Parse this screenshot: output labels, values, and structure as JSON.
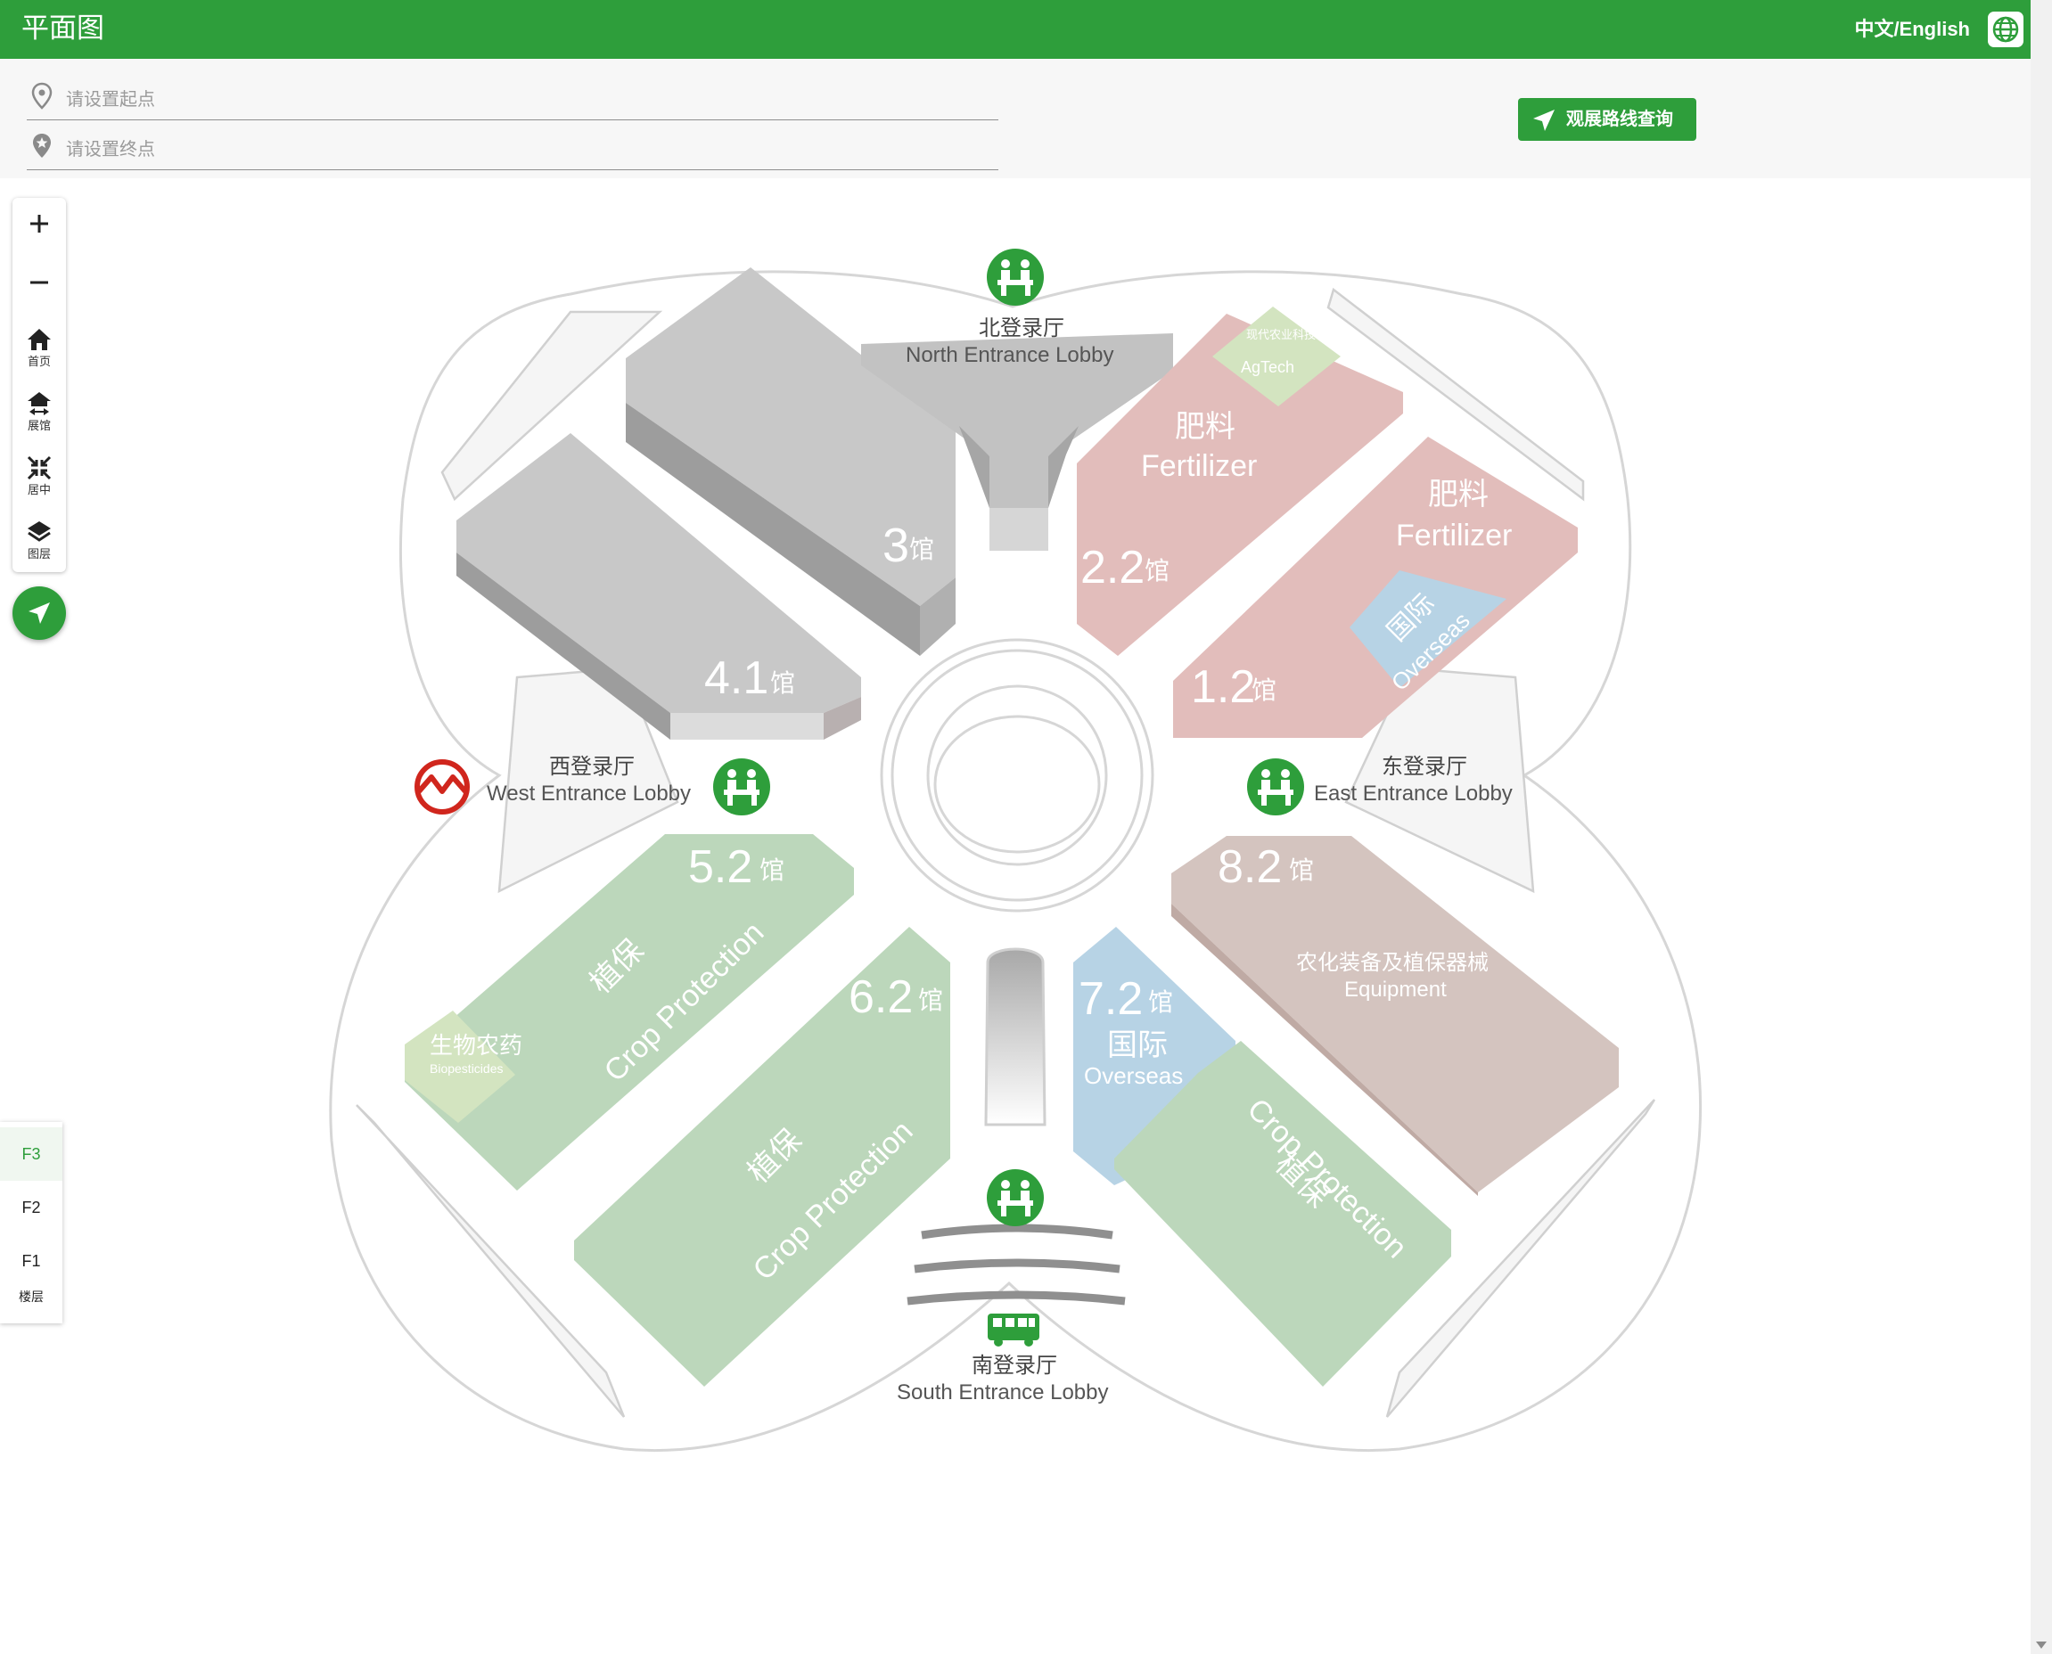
{
  "app": {
    "title": "平面图",
    "lang_toggle": "中文/English"
  },
  "route": {
    "start_placeholder": "请设置起点",
    "end_placeholder": "请设置终点",
    "query_label": "观展路线查询"
  },
  "tools": {
    "zoom_in": "zoom-in-icon",
    "zoom_out": "zoom-out-icon",
    "home": {
      "label": "首页",
      "icon": "home-icon"
    },
    "halls": {
      "label": "展馆",
      "icon": "hall-switch-icon"
    },
    "center": {
      "label": "居中",
      "icon": "center-icon"
    },
    "layers": {
      "label": "图层",
      "icon": "layers-icon"
    },
    "locate": "navigate-icon"
  },
  "floors": {
    "items": [
      "F3",
      "F2",
      "F1"
    ],
    "active": "F3",
    "caption": "楼层"
  },
  "lobbies": {
    "north": {
      "cn": "北登录厅",
      "en": "North Entrance Lobby"
    },
    "west": {
      "cn": "西登录厅",
      "en": "West Entrance Lobby"
    },
    "east": {
      "cn": "东登录厅",
      "en": "East Entrance Lobby"
    },
    "south": {
      "cn": "南登录厅",
      "en": "South Entrance Lobby"
    }
  },
  "halls": {
    "h3": {
      "num": "3",
      "unit": "馆"
    },
    "h41": {
      "num": "4.1",
      "unit": "馆"
    },
    "h22": {
      "num": "2.2",
      "unit": "馆",
      "zone_cn": "肥料",
      "zone_en": "Fertilizer",
      "sub_cn": "现代农业科技",
      "sub_en": "AgTech"
    },
    "h12": {
      "num": "1.2",
      "unit": "馆",
      "zone_cn": "肥料",
      "zone_en": "Fertilizer",
      "sub_cn": "国际",
      "sub_en": "Overseas"
    },
    "h52": {
      "num": "5.2",
      "unit": "馆",
      "zone_cn": "植保",
      "zone_en": "Crop Protection",
      "sub_cn": "生物农药",
      "sub_en": "Biopesticides"
    },
    "h62": {
      "num": "6.2",
      "unit": "馆",
      "zone_cn": "植保",
      "zone_en": "Crop Protection"
    },
    "h72": {
      "num": "7.2",
      "unit": "馆",
      "zone_cn": "植保",
      "zone_en": "Crop Protection",
      "sub_cn": "国际",
      "sub_en": "Overseas"
    },
    "h82": {
      "num": "8.2",
      "unit": "馆",
      "zone_cn": "农化装备及植保器械",
      "zone_en": "Equipment"
    }
  },
  "colors": {
    "brand": "#2e9e3b",
    "gray_hall": "#c4c4c4",
    "fertilizer": "#e2bdbb",
    "crop_protection": "#bcd7bb",
    "overseas": "#b7d3e5",
    "agtech": "#d3e4c0",
    "equipment": "#d4c4bf",
    "metro": "#d0261d"
  },
  "icons": {
    "metro": "metro-logo",
    "reception": "reception-desk-icon",
    "bus": "bus-icon"
  }
}
